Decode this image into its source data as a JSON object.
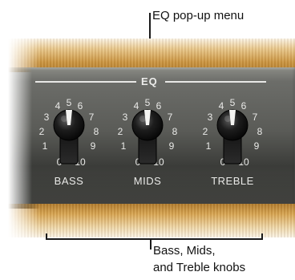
{
  "callouts": {
    "top": "EQ pop-up menu",
    "bottom_line1": "Bass, Mids,",
    "bottom_line2": "and Treble knobs"
  },
  "panel": {
    "eq_title": "EQ",
    "knobs": [
      {
        "label": "BASS"
      },
      {
        "label": "MIDS"
      },
      {
        "label": "TREBLE"
      }
    ],
    "scale": [
      "0",
      "1",
      "2",
      "3",
      "4",
      "5",
      "6",
      "7",
      "8",
      "9",
      "10"
    ]
  },
  "icons": {
    "knob": "rotary-knob-icon"
  },
  "colors": {
    "tolex": "#c9933f",
    "faceplate": "#5a5b57",
    "label": "#e9e9e7"
  }
}
